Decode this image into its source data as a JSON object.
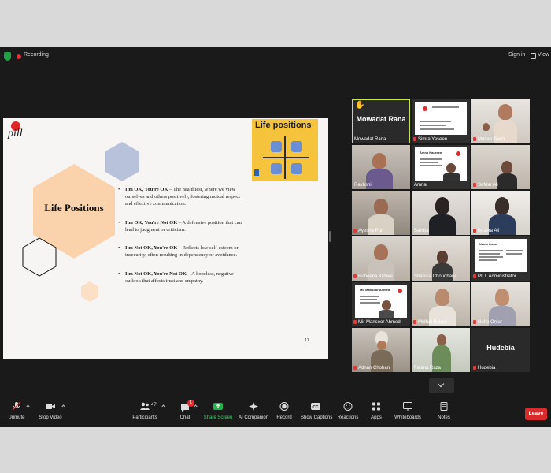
{
  "topbar": {
    "recording_label": "Recording",
    "signin_label": "Sign in",
    "view_label": "View"
  },
  "slide": {
    "logo_text": "pill",
    "title": "Life Positions",
    "image_title": "Life positions",
    "page_number": "11",
    "bullets": [
      {
        "bold": "I'm OK, You're OK",
        "text": " – The healthiest, where we view ourselves and others positively, fostering mutual respect and effective communication."
      },
      {
        "bold": "I'm OK, You're Not OK",
        "text": " – A defensive position that can lead to judgment or criticism."
      },
      {
        "bold": "I'm Not OK, You're OK",
        "text": " – Reflects low self-esteem or insecurity, often resulting in dependency or avoidance."
      },
      {
        "bold": "I'm Not OK, You're Not OK",
        "text": " – A hopeless, negative outlook that affects trust and empathy."
      }
    ]
  },
  "participants": [
    {
      "name": "Mowadat Rana",
      "display": "Mowadat Rana"
    },
    {
      "name": "Simra Yaseen"
    },
    {
      "name": "Multan Team"
    },
    {
      "name": "Rakhshi"
    },
    {
      "name": "Amna"
    },
    {
      "name": "Safdar Ali"
    },
    {
      "name": "Ayesha Puri"
    },
    {
      "name": "Sahiba"
    },
    {
      "name": "Bushra Ali"
    },
    {
      "name": "Rubeena Kidwai"
    },
    {
      "name": "Shamsa Choudhary"
    },
    {
      "name": "PILL Administrator"
    },
    {
      "name": "Mir Mansoor Ahmed"
    },
    {
      "name": "Midhat Batool"
    },
    {
      "name": "Neha Omar"
    },
    {
      "name": "Adnan Chohan"
    },
    {
      "name": "Fatima Raza"
    },
    {
      "name": "Hudebia",
      "display": "Hudebia"
    }
  ],
  "tile_text": {
    "amna_header": "Amna Naureen",
    "uzma_header": "Uzma Omar",
    "mir_header": "Mir Mansoor Ahmed"
  },
  "toolbar": {
    "unmute": "Unmute",
    "stop_video": "Stop Video",
    "participants": "Participants",
    "participants_count": "47",
    "chat": "Chat",
    "chat_badge": "1",
    "share_screen": "Share Screen",
    "ai_companion": "AI Companion",
    "record": "Record",
    "show_captions": "Show Captions",
    "reactions": "Reactions",
    "apps": "Apps",
    "whiteboards": "Whiteboards",
    "notes": "Notes",
    "leave": "Leave"
  },
  "colors": {
    "accent_green": "#21a045",
    "active_outline": "#c8e64c",
    "leave_red": "#d92b2b",
    "slide_orange": "#fad3ad",
    "slide_blue": "#b8c3db"
  }
}
